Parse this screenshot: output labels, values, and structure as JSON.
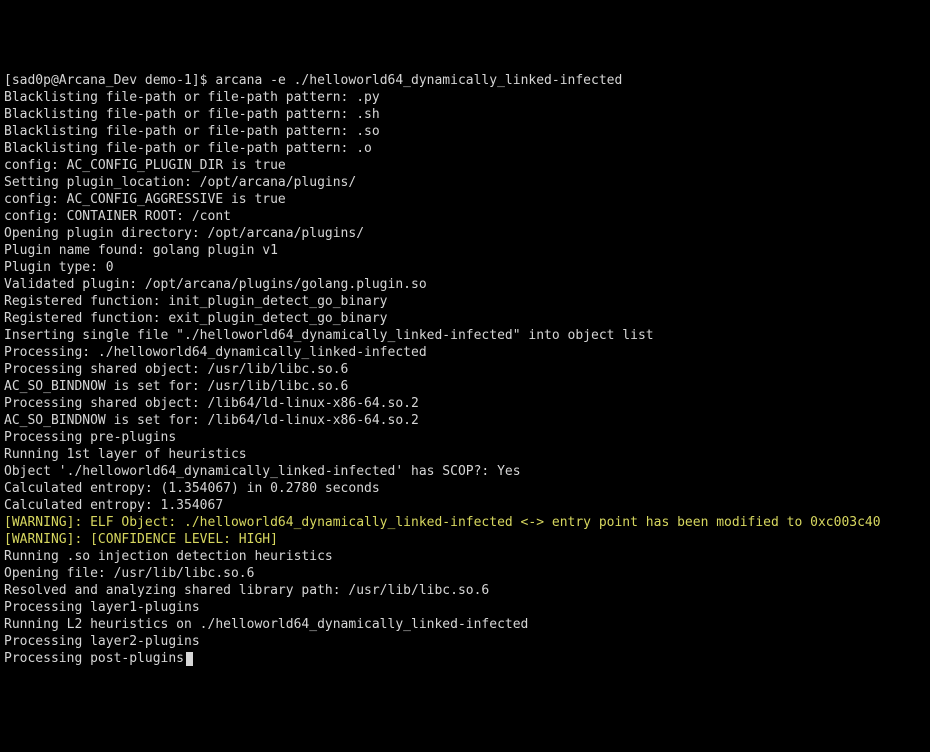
{
  "prompt": {
    "full": "[sad0p@Arcana_Dev demo-1]$ ",
    "command": "arcana -e ./helloworld64_dynamically_linked-infected"
  },
  "lines": [
    "Blacklisting file-path or file-path pattern: .py",
    "Blacklisting file-path or file-path pattern: .sh",
    "Blacklisting file-path or file-path pattern: .so",
    "Blacklisting file-path or file-path pattern: .o",
    "config: AC_CONFIG_PLUGIN_DIR is true",
    "Setting plugin_location: /opt/arcana/plugins/",
    "config: AC_CONFIG_AGGRESSIVE is true",
    "config: CONTAINER ROOT: /cont",
    "Opening plugin directory: /opt/arcana/plugins/",
    "Plugin name found: golang plugin v1",
    "Plugin type: 0",
    "Validated plugin: /opt/arcana/plugins/golang.plugin.so",
    "Registered function: init_plugin_detect_go_binary",
    "Registered function: exit_plugin_detect_go_binary",
    "Inserting single file \"./helloworld64_dynamically_linked-infected\" into object list",
    "Processing: ./helloworld64_dynamically_linked-infected",
    "Processing shared object: /usr/lib/libc.so.6",
    "AC_SO_BINDNOW is set for: /usr/lib/libc.so.6",
    "Processing shared object: /lib64/ld-linux-x86-64.so.2",
    "AC_SO_BINDNOW is set for: /lib64/ld-linux-x86-64.so.2",
    "Processing pre-plugins",
    "Running 1st layer of heuristics",
    "Object './helloworld64_dynamically_linked-infected' has SCOP?: Yes",
    "Calculated entropy: (1.354067) in 0.2780 seconds",
    "Calculated entropy: 1.354067"
  ],
  "warnings": [
    "[WARNING]: ELF Object: ./helloworld64_dynamically_linked-infected <-> entry point has been modified to 0xc003c40",
    "[WARNING]: [CONFIDENCE LEVEL: HIGH]"
  ],
  "lines_after": [
    "Running .so injection detection heuristics",
    "Opening file: /usr/lib/libc.so.6",
    "Resolved and analyzing shared library path: /usr/lib/libc.so.6",
    "Processing layer1-plugins",
    "Running L2 heuristics on ./helloworld64_dynamically_linked-infected",
    "Processing layer2-plugins",
    "",
    "Processing post-plugins"
  ]
}
